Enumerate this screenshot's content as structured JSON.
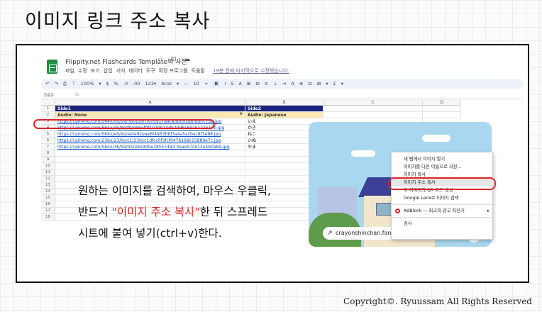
{
  "slide": {
    "title": "이미지 링크 주소 복사",
    "footer": "Copyright©. Ryuussam All Rights Reserved"
  },
  "sheets": {
    "doc_title": "Flippity.net Flashcards Template의 사본",
    "title_icons": "☆ ⊡ ☁",
    "menu": [
      "파일",
      "수정",
      "보기",
      "삽입",
      "서식",
      "데이터",
      "도구",
      "확장 프로그램",
      "도움말"
    ],
    "last_edit": "19분 전에 마지막으로 수정했습니다.",
    "toolbar": [
      "↶",
      "↷",
      "⎙",
      "⊤",
      "100%",
      "▾",
      "$",
      "%",
      ".0",
      ".00",
      "123▾",
      "Arial",
      "▾",
      "—",
      "10",
      "+",
      "B",
      "I",
      "S",
      "A",
      "⊞",
      "⊟",
      "≡",
      "⊥",
      "⇥",
      "A",
      "⊕",
      "⊡",
      "⊞",
      "▾",
      "Σ",
      "▾"
    ],
    "name_box": "D22",
    "fx": "fx",
    "columns": [
      "A",
      "B",
      "C",
      "D"
    ],
    "rows": [
      {
        "num": "1",
        "a": "Side1",
        "b": "Side2",
        "style": "hdr1"
      },
      {
        "num": "2",
        "a": "Audio: None",
        "b": "Audio: Japanese",
        "style": "hdr2"
      },
      {
        "num": "3",
        "a": "https://i.pinimg.com/564x/0d/39/f9/0d397fc05917aac43b051d6fddffc7b2.jpg",
        "b": "いえ",
        "style": "link"
      },
      {
        "num": "4",
        "a": "https://i.pinimg.com/564x/eb/be/f9/ebbef9f1079b14db29d6c65a5a22517b.jpg",
        "b": "かき",
        "style": "link"
      },
      {
        "num": "5",
        "a": "https://i.pinimg.com/564x/e9/2e/ae/e92eae6f4963fdd3a4a5acbec8f3488.jpg",
        "b": "ねこ",
        "style": "link"
      },
      {
        "num": "6",
        "a": "https://i.pinimg.com/236x/23/0c/c1/230cc1dfcc0f3fcf047b168c15889e7c.jpg",
        "b": "いぬ",
        "style": "link"
      },
      {
        "num": "7",
        "a": "https://i.pinimg.com/564x/36/59/45/365945e78557494 3eae57cb13e560a84.jpg",
        "b": "やま",
        "style": "link"
      },
      {
        "num": "8",
        "a": "",
        "b": "",
        "style": ""
      },
      {
        "num": "9",
        "a": "",
        "b": "",
        "style": ""
      },
      {
        "num": "10",
        "a": "",
        "b": "",
        "style": ""
      },
      {
        "num": "11",
        "a": "",
        "b": "",
        "style": ""
      },
      {
        "num": "12",
        "a": "",
        "b": "",
        "style": ""
      },
      {
        "num": "13",
        "a": "",
        "b": "",
        "style": ""
      },
      {
        "num": "14",
        "a": "",
        "b": "",
        "style": ""
      },
      {
        "num": "15",
        "a": "",
        "b": "",
        "style": ""
      },
      {
        "num": "16",
        "a": "",
        "b": "",
        "style": ""
      },
      {
        "num": "17",
        "a": "",
        "b": "",
        "style": ""
      },
      {
        "num": "18",
        "a": "",
        "b": "",
        "style": ""
      }
    ]
  },
  "instruction": {
    "line1": "원하는 이미지를 검색하여, 마우스 우클릭,",
    "line2_pre": "반드시 ",
    "line2_highlight": "\"이미지 주소 복사\"",
    "line2_post": "한 뒤 스프레드",
    "line3": "시트에 붙여 넣기(ctrl+v)한다."
  },
  "preview": {
    "source_label": "crayonshinchan.fando",
    "source_icon": "↗",
    "expand_icon": "⤢"
  },
  "context_menu": {
    "items": [
      {
        "label": "새 탭에서 이미지 열기"
      },
      {
        "label": "이미지를 다른 이름으로 저장..."
      },
      {
        "label": "이미지 복사"
      },
      {
        "label": "이미지 주소 복사",
        "selected": true
      },
      {
        "label": "이 이미지의 QR 코드 생성"
      },
      {
        "label": "Google Lens로 이미지 검색"
      },
      {
        "label": "AdBlock — 최고의 광고 차단기",
        "icon": "opera",
        "submenu": "▸"
      },
      {
        "label": "검사"
      }
    ]
  },
  "colors": {
    "highlight_red": "#d9262a",
    "sheet_header": "#1a237e",
    "sheet_subheader": "#fce8b2",
    "link": "#1155cc"
  }
}
